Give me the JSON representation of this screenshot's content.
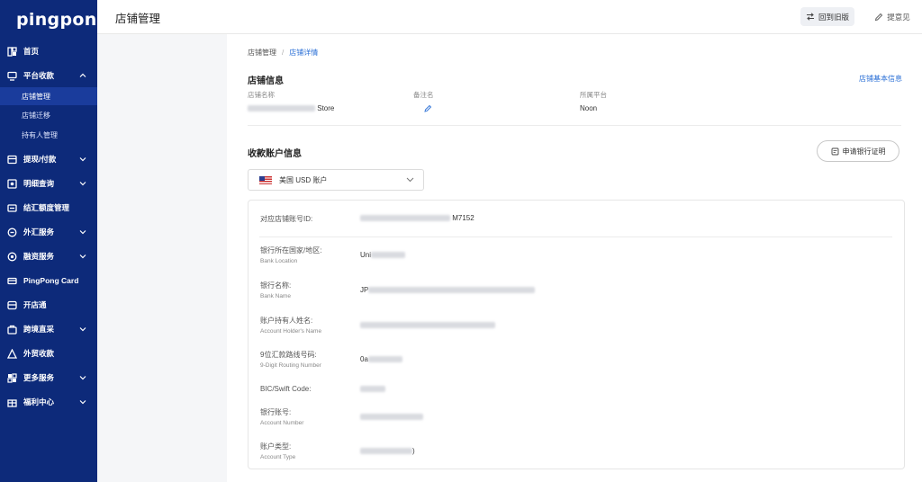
{
  "app": {
    "logo": "pingpong"
  },
  "sidebar": {
    "items": [
      {
        "label": "首页",
        "icon": "home-icon"
      },
      {
        "label": "平台收款",
        "icon": "monitor-icon",
        "expanded": true
      },
      {
        "label": "提现/付款",
        "icon": "withdraw-icon"
      },
      {
        "label": "明细查询",
        "icon": "detail-icon"
      },
      {
        "label": "结汇额度管理",
        "icon": "quota-icon"
      },
      {
        "label": "外汇服务",
        "icon": "fx-icon"
      },
      {
        "label": "融资服务",
        "icon": "finance-icon"
      },
      {
        "label": "PingPong Card",
        "icon": "card-icon"
      },
      {
        "label": "开店通",
        "icon": "store-icon"
      },
      {
        "label": "跨境直采",
        "icon": "purchase-icon"
      },
      {
        "label": "外贸收款",
        "icon": "trade-icon"
      },
      {
        "label": "更多服务",
        "icon": "more-icon"
      },
      {
        "label": "福利中心",
        "icon": "gift-icon"
      }
    ],
    "sub_items": [
      {
        "label": "店铺管理",
        "active": true
      },
      {
        "label": "店铺迁移",
        "active": false
      },
      {
        "label": "持有人管理",
        "active": false
      }
    ]
  },
  "header": {
    "title": "店铺管理",
    "back_old_label": "回到旧版",
    "feedback_label": "提意见"
  },
  "breadcrumb": {
    "root": "店铺管理",
    "separator": "/",
    "current": "店铺详情"
  },
  "store_info": {
    "title": "店铺信息",
    "basic_link": "店铺基本信息",
    "labels": {
      "name": "店铺名称",
      "remark": "备注名",
      "platform": "所属平台"
    },
    "name_visible_suffix": "Store",
    "platform": "Noon"
  },
  "account_info": {
    "title": "收款账户信息",
    "cert_button": "申请银行证明",
    "selected_account": "美国 USD 账户",
    "fields": [
      {
        "label": "对应店铺账号ID:",
        "sub": "",
        "visible": "M7152"
      },
      {
        "label": "银行所在国家/地区:",
        "sub": "Bank Location",
        "visible": "Uni"
      },
      {
        "label": "银行名称:",
        "sub": "Bank Name",
        "visible": "JP"
      },
      {
        "label": "账户持有人姓名:",
        "sub": "Account Holder's Name",
        "visible": ""
      },
      {
        "label": "9位汇款路线号码:",
        "sub": "9-Digit Routing Number",
        "visible": "0a"
      },
      {
        "label": "BIC/Swift Code:",
        "sub": "",
        "visible": ""
      },
      {
        "label": "银行账号:",
        "sub": "Account Number",
        "visible": ""
      },
      {
        "label": "账户类型:",
        "sub": "Account Type",
        "visible": ")"
      }
    ]
  },
  "colors": {
    "sidebar_bg": "#0d2a7a",
    "active_sub_bg": "#1a3c9c",
    "link": "#2a6fd6"
  }
}
